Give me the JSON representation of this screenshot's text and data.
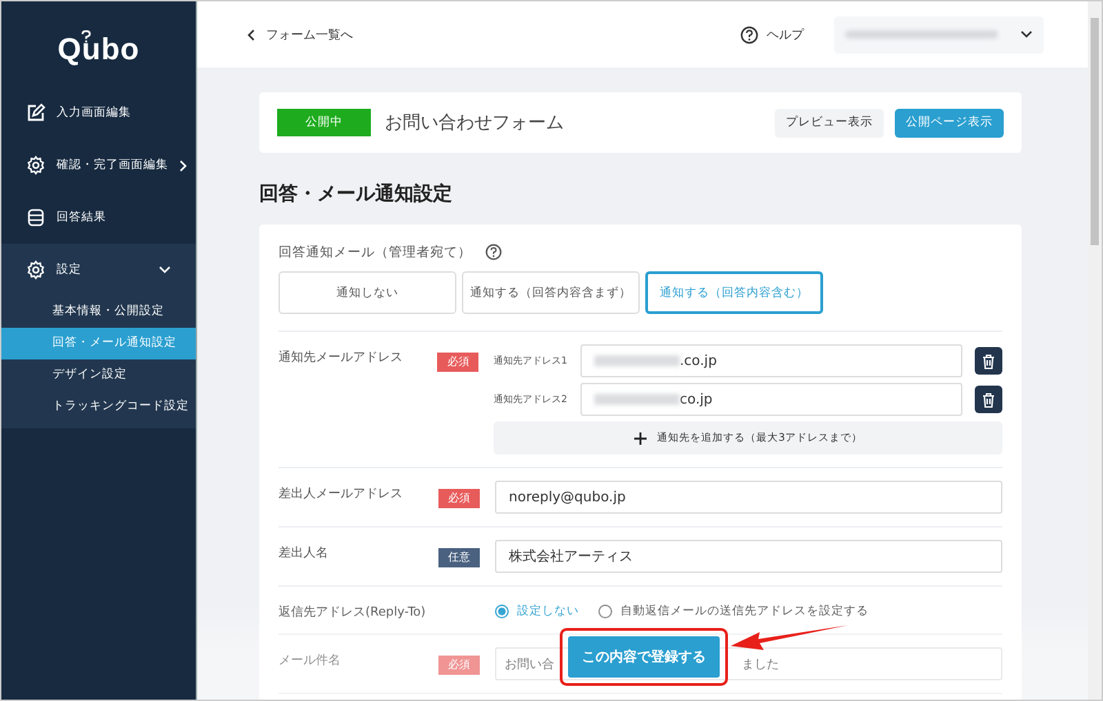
{
  "logo": "Qubo",
  "sidebar": {
    "items": [
      {
        "label": "入力画面編集"
      },
      {
        "label": "確認・完了画面編集",
        "expanded": false
      },
      {
        "label": "回答結果"
      },
      {
        "label": "設定",
        "expanded": true,
        "children": [
          {
            "label": "基本情報・公開設定",
            "selected": false
          },
          {
            "label": "回答・メール通知設定",
            "selected": true
          },
          {
            "label": "デザイン設定",
            "selected": false
          },
          {
            "label": "トラッキングコード設定",
            "selected": false
          }
        ]
      }
    ]
  },
  "topbar": {
    "back_link": "フォーム一覧へ",
    "help": "ヘルプ"
  },
  "form_header": {
    "status": "公開中",
    "title": "お問い合わせフォーム",
    "buttons": [
      {
        "label": "プレビュー表示",
        "kind": "secondary"
      },
      {
        "label": "公開ページ表示",
        "kind": "primary"
      }
    ]
  },
  "page_title": "回答・メール通知設定",
  "notify": {
    "label": "回答通知メール（管理者宛て）",
    "options": [
      {
        "label": "通知しない",
        "selected": false
      },
      {
        "label": "通知する（回答内容含まず）",
        "selected": false
      },
      {
        "label": "通知する（回答内容含む）",
        "selected": true
      }
    ]
  },
  "rows": [
    {
      "kind": "emails",
      "label": "通知先メールアドレス",
      "badge": {
        "text": "必須",
        "required": true
      },
      "addresses": [
        {
          "label": "通知先アドレス1",
          "value": ".co.jp"
        },
        {
          "label": "通知先アドレス2",
          "value": "co.jp"
        }
      ],
      "add_button": "通知先を追加する（最大3アドレスまで）"
    },
    {
      "kind": "input",
      "label": "差出人メールアドレス",
      "badge": {
        "text": "必須",
        "required": true
      },
      "value": "noreply@qubo.jp"
    },
    {
      "kind": "input",
      "label": "差出人名",
      "badge": {
        "text": "任意",
        "required": false
      },
      "value": "株式会社アーティス"
    },
    {
      "kind": "radio",
      "label": "返信先アドレス(Reply-To)",
      "options": [
        {
          "label": "設定しない",
          "selected": true
        },
        {
          "label": "自動返信メールの送信先アドレスを設定する",
          "selected": false
        }
      ]
    },
    {
      "kind": "input",
      "label": "メール件名",
      "badge": {
        "text": "必須",
        "required": true
      },
      "value": "お問い合",
      "value_tail": "ました"
    }
  ],
  "submit_button": "この内容で登録する"
}
